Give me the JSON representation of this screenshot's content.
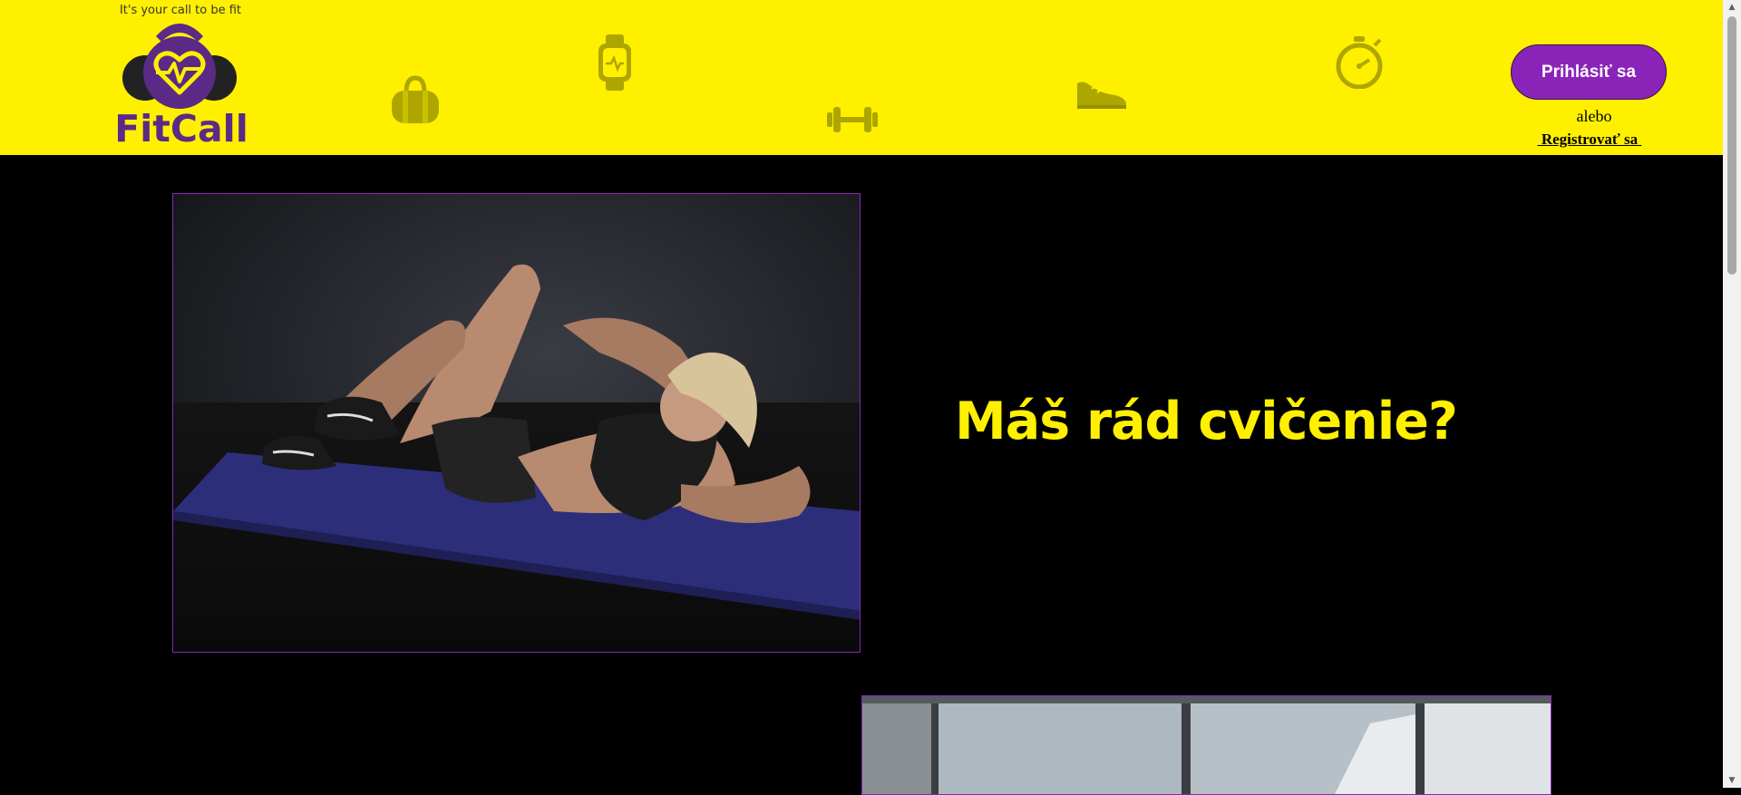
{
  "header": {
    "tagline": "It's your call to be fit",
    "brand": "FitCall",
    "decor_icons": [
      "gym-bag-icon",
      "smartwatch-icon",
      "dumbbell-icon",
      "sneaker-icon",
      "stopwatch-icon"
    ],
    "login_label": "Prihlásiť sa",
    "or_label": "alebo",
    "register_label": " Registrovať sa "
  },
  "main": {
    "hero_title": "Máš rád cvičenie?"
  },
  "colors": {
    "header_bg": "#FFF000",
    "brand_purple": "#5B2A86",
    "button_purple": "#8A24B8",
    "page_bg": "#000000",
    "headline_yellow": "#FFF000"
  }
}
